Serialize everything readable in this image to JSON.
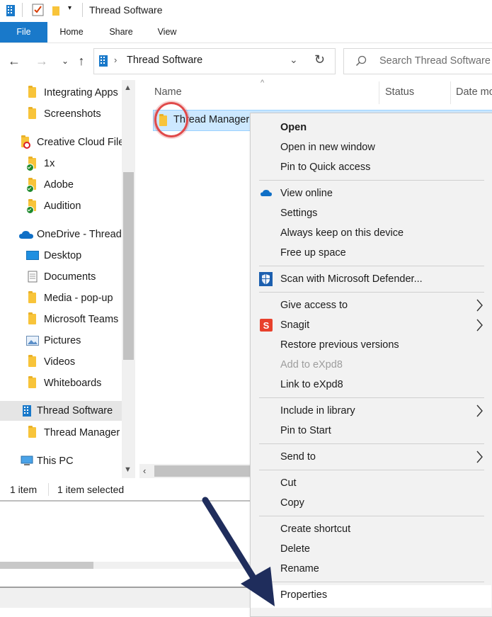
{
  "window": {
    "title": "Thread Software"
  },
  "ribbon": {
    "tabs": [
      "File",
      "Home",
      "Share",
      "View"
    ]
  },
  "address": {
    "path": "Thread Software",
    "search_placeholder": "Search Thread Software"
  },
  "sidebar": {
    "items": [
      {
        "label": "Integrating Apps",
        "icon": "folder-icon"
      },
      {
        "label": "Screenshots",
        "icon": "folder-icon"
      },
      {
        "label": "Creative Cloud Files",
        "icon": "creative-cloud-folder-icon"
      },
      {
        "label": "1x",
        "icon": "folder-synced-icon"
      },
      {
        "label": "Adobe",
        "icon": "folder-synced-icon"
      },
      {
        "label": "Audition",
        "icon": "folder-synced-icon"
      },
      {
        "label": "OneDrive - Thread",
        "icon": "onedrive-cloud-icon"
      },
      {
        "label": "Desktop",
        "icon": "desktop-icon"
      },
      {
        "label": "Documents",
        "icon": "documents-icon"
      },
      {
        "label": "Media - pop-up",
        "icon": "folder-icon"
      },
      {
        "label": "Microsoft Teams",
        "icon": "folder-icon"
      },
      {
        "label": "Pictures",
        "icon": "pictures-icon"
      },
      {
        "label": "Videos",
        "icon": "folder-icon"
      },
      {
        "label": "Whiteboards",
        "icon": "folder-icon"
      },
      {
        "label": "Thread Software",
        "icon": "building-icon"
      },
      {
        "label": "Thread Manager",
        "icon": "folder-icon"
      },
      {
        "label": "This PC",
        "icon": "computer-icon"
      }
    ]
  },
  "columns": [
    "Name",
    "Status",
    "Date mo"
  ],
  "files": [
    {
      "name": "Thread Manager"
    }
  ],
  "status": {
    "count": "1 item",
    "selected": "1 item selected"
  },
  "context_menu": {
    "items": [
      {
        "label": "Open",
        "bold": true
      },
      {
        "label": "Open in new window"
      },
      {
        "label": "Pin to Quick access"
      },
      {
        "label": "View online",
        "icon": "onedrive-cloud-icon"
      },
      {
        "label": "Settings"
      },
      {
        "label": "Always keep on this device"
      },
      {
        "label": "Free up space"
      },
      {
        "label": "Scan with Microsoft Defender...",
        "icon": "defender-shield-icon"
      },
      {
        "label": "Give access to",
        "submenu": true
      },
      {
        "label": "Snagit",
        "icon": "snagit-icon",
        "submenu": true
      },
      {
        "label": "Restore previous versions"
      },
      {
        "label": "Add to eXpd8",
        "disabled": true
      },
      {
        "label": "Link to eXpd8"
      },
      {
        "label": "Include in library",
        "submenu": true
      },
      {
        "label": "Pin to Start"
      },
      {
        "label": "Send to",
        "submenu": true
      },
      {
        "label": "Cut"
      },
      {
        "label": "Copy"
      },
      {
        "label": "Create shortcut"
      },
      {
        "label": "Delete"
      },
      {
        "label": "Rename"
      },
      {
        "label": "Properties"
      }
    ]
  },
  "colors": {
    "accent": "#1979ca",
    "selection": "#cce8ff",
    "annotation_circle": "#e04a4a",
    "annotation_arrow": "#1f2d5c"
  }
}
